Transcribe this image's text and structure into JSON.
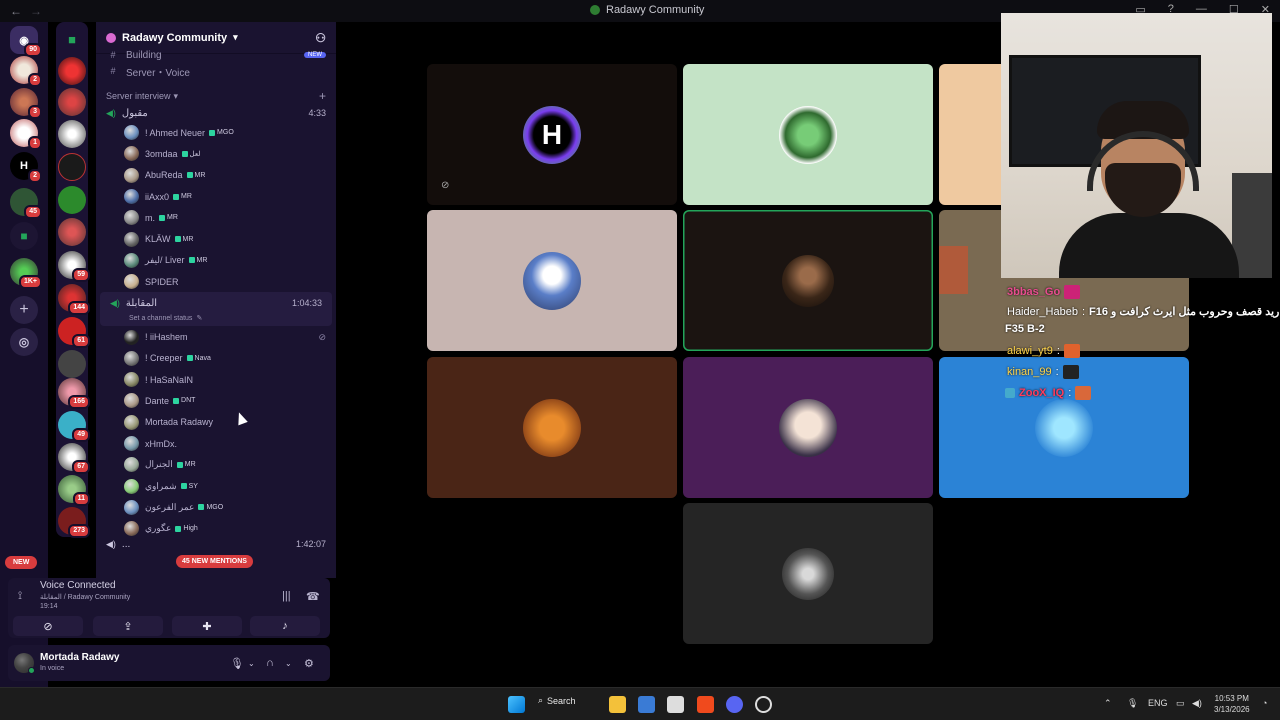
{
  "window": {
    "title": "Radawy Community",
    "back": "←",
    "forward": "→",
    "min": "—",
    "max": "☐",
    "close": "✕"
  },
  "rail": {
    "badges": [
      "90",
      "2",
      "3",
      "1",
      "2",
      "45",
      "59",
      "144",
      "61",
      "166",
      "49",
      "67",
      "11",
      "273",
      "1K+"
    ]
  },
  "server": {
    "name": "Radawy Community",
    "add_icon": "add-member-icon"
  },
  "channels": {
    "partial_top": "Building",
    "partial_top_pill": "NEW",
    "server_voice": "Server・Voice",
    "category": "Server interview",
    "vc1": {
      "name": "مقبول",
      "time": "4:33"
    },
    "vc1_users": [
      {
        "name": "! Ahmed Neuer",
        "tag": "MGO"
      },
      {
        "name": "3omdaa",
        "tag": "لعل"
      },
      {
        "name": "AbuReda",
        "tag": "MR"
      },
      {
        "name": "iiAxx0",
        "tag": "MR"
      },
      {
        "name": "m.",
        "tag": "MR"
      },
      {
        "name": "KLÄW",
        "tag": "MR"
      },
      {
        "name": "ليفر/ Liver",
        "tag": "MR"
      },
      {
        "name": "SPIDER",
        "tag": ""
      }
    ],
    "vc2": {
      "name": "المقابلة",
      "time": "1:04:33",
      "status_hint": "Set a channel status"
    },
    "vc2_users": [
      {
        "name": "! iiHashem",
        "tag": ""
      },
      {
        "name": "! Creeper",
        "tag": "Nava"
      },
      {
        "name": "! HaSaNaIN",
        "tag": ""
      },
      {
        "name": "Dante",
        "tag": "DNT"
      },
      {
        "name": "Mortada Radawy",
        "tag": ""
      },
      {
        "name": "xHmDx.",
        "tag": ""
      },
      {
        "name": "الجنرال",
        "tag": "MR"
      },
      {
        "name": "شمراوي",
        "tag": "SY"
      },
      {
        "name": "عمر الفرعون",
        "tag": "MGO"
      },
      {
        "name": "عگوري",
        "tag": "High"
      }
    ],
    "partial_bottom": {
      "name": "...",
      "time": "1:42:07"
    }
  },
  "pills": {
    "new": "NEW",
    "mentions": "45 NEW MENTIONS"
  },
  "voice": {
    "title": "Voice Connected",
    "channel": "المقابلة / Radawy Community",
    "elapsed": "19:14"
  },
  "user": {
    "name": "Mortada Radawy",
    "status": "In voice"
  },
  "chat": [
    {
      "name": "3bbas_Go",
      "text": "",
      "color": "#e84c8f"
    },
    {
      "name": "Haider_Habeb",
      "text": "F16 اريد قصف وحروب مثل ايرث كرافت و",
      "color": "#ffffff"
    },
    {
      "name": "",
      "text": "F35 B-2",
      "color": "#ffffff"
    },
    {
      "name": "alawi_yt9",
      "text": ":",
      "color": "#ffd54a"
    },
    {
      "name": "kinan_99",
      "text": ":",
      "color": "#ffd54a"
    },
    {
      "name": "ZooX_IQ",
      "text": ":",
      "color": "#ff3b5c"
    }
  ],
  "taskbar": {
    "search": "Search",
    "lang": "ENG",
    "time": "10:53 PM",
    "date": "3/13/2026"
  }
}
